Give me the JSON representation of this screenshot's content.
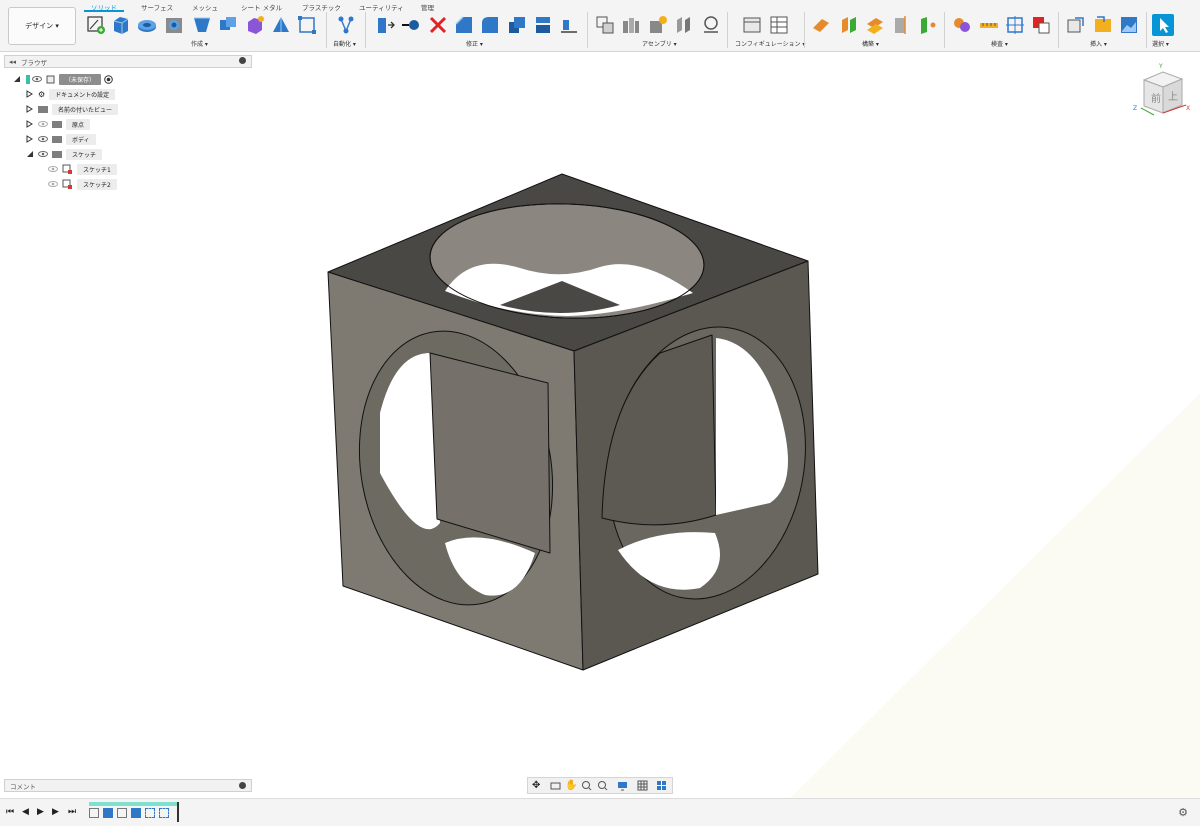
{
  "workspace": {
    "label": "デザイン ▾"
  },
  "tabs": [
    "ソリッド",
    "サーフェス",
    "メッシュ",
    "シート メタル",
    "プラスチック",
    "ユーティリティ",
    "管理"
  ],
  "toolbar_groups": {
    "create": "作成 ▾",
    "automate": "自動化 ▾",
    "modify": "修正 ▾",
    "assemble": "アセンブリ ▾",
    "configure": "コンフィギュレーション ▾",
    "construct": "構築 ▾",
    "inspect": "検査 ▾",
    "insert": "挿入 ▾",
    "select": "選択 ▾"
  },
  "browser": {
    "title": "ブラウザ",
    "root": "（未保存）",
    "items": [
      "ドキュメントの設定",
      "名前の付いたビュー",
      "原点",
      "ボディ",
      "スケッチ"
    ],
    "sketches": [
      "スケッチ1",
      "スケッチ2"
    ]
  },
  "comments": {
    "title": "コメント"
  },
  "viewcube": {
    "top": "上",
    "front": "前",
    "axis_x": "X",
    "axis_y": "Y",
    "axis_z": "Z"
  },
  "colors": {
    "accent": "#0696d7",
    "body": "#7f7b72",
    "edge": "#111111"
  }
}
